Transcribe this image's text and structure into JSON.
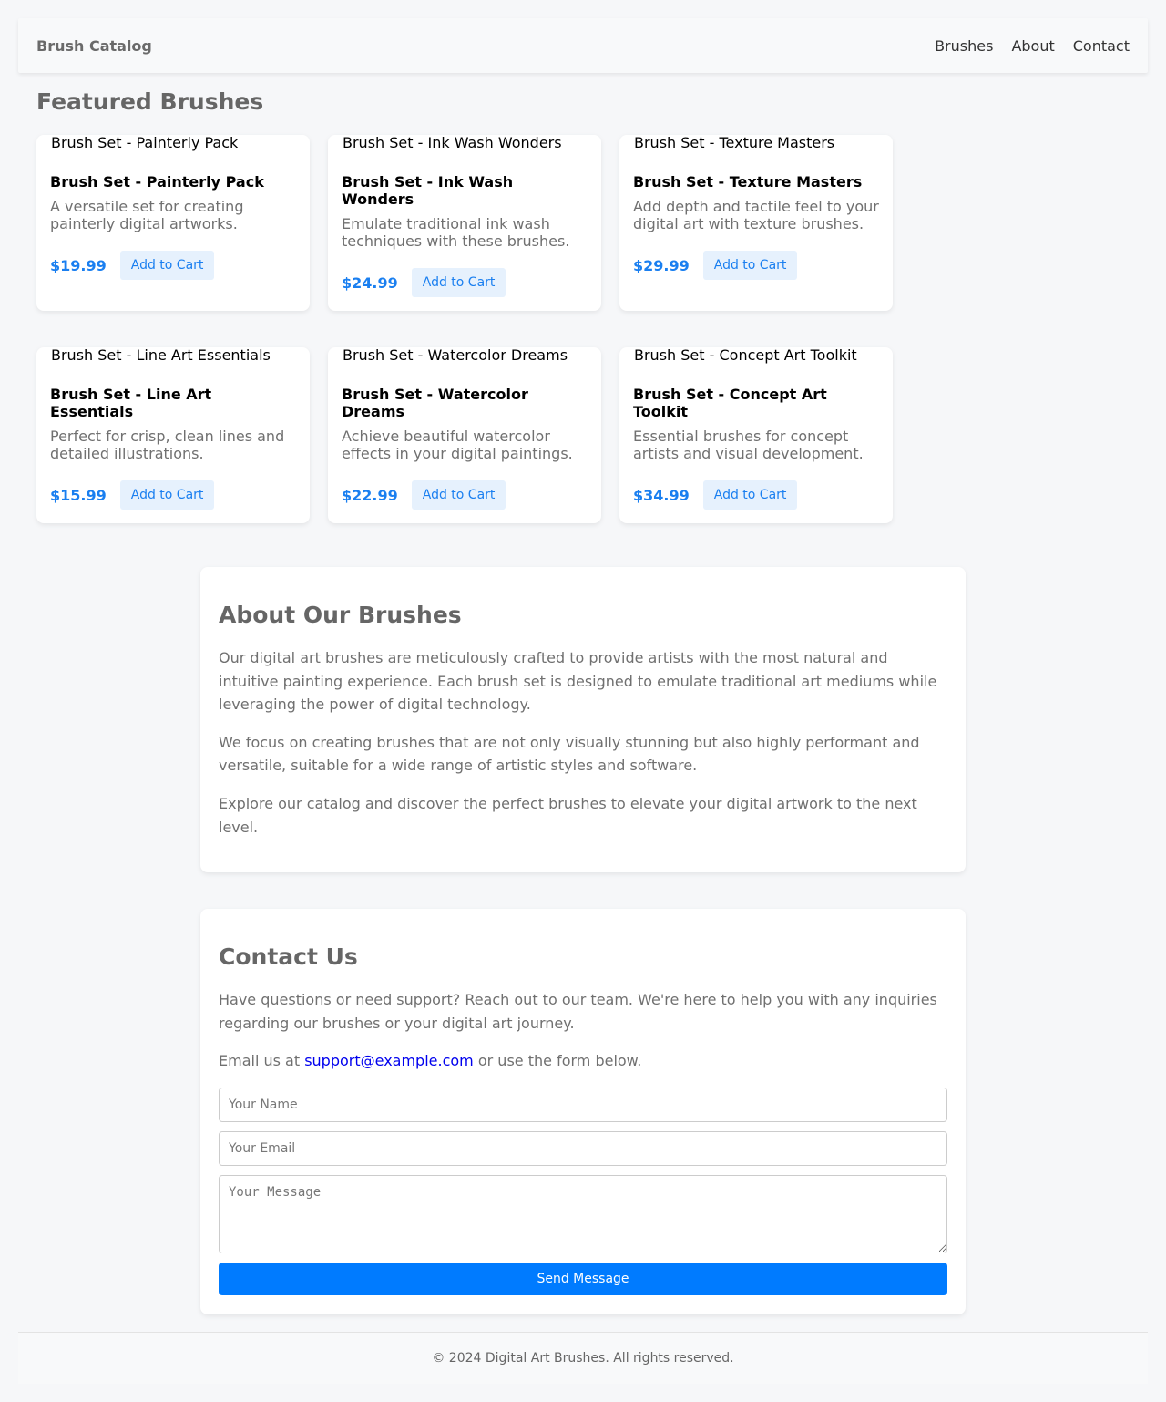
{
  "navbar": {
    "brand": "Brush Catalog",
    "links": [
      "Brushes",
      "About",
      "Contact"
    ]
  },
  "featured": {
    "title": "Featured Brushes",
    "add_label": "Add to Cart",
    "products": [
      {
        "image_alt": "Brush Set - Painterly Pack",
        "name": "Brush Set - Painterly Pack",
        "description": "A versatile set for creating painterly digital artworks.",
        "price": "$19.99"
      },
      {
        "image_alt": "Brush Set - Ink Wash Wonders",
        "name": "Brush Set - Ink Wash Wonders",
        "description": "Emulate traditional ink wash techniques with these brushes.",
        "price": "$24.99"
      },
      {
        "image_alt": "Brush Set - Texture Masters",
        "name": "Brush Set - Texture Masters",
        "description": "Add depth and tactile feel to your digital art with texture brushes.",
        "price": "$29.99"
      },
      {
        "image_alt": "Brush Set - Line Art Essentials",
        "name": "Brush Set - Line Art Essentials",
        "description": "Perfect for crisp, clean lines and detailed illustrations.",
        "price": "$15.99"
      },
      {
        "image_alt": "Brush Set - Watercolor Dreams",
        "name": "Brush Set - Watercolor Dreams",
        "description": "Achieve beautiful watercolor effects in your digital paintings.",
        "price": "$22.99"
      },
      {
        "image_alt": "Brush Set - Concept Art Toolkit",
        "name": "Brush Set - Concept Art Toolkit",
        "description": "Essential brushes for concept artists and visual development.",
        "price": "$34.99"
      }
    ]
  },
  "about": {
    "title": "About Our Brushes",
    "paragraphs": [
      "Our digital art brushes are meticulously crafted to provide artists with the most natural and intuitive painting experience. Each brush set is designed to emulate traditional art mediums while leveraging the power of digital technology.",
      "We focus on creating brushes that are not only visually stunning but also highly performant and versatile, suitable for a wide range of artistic styles and software.",
      "Explore our catalog and discover the perfect brushes to elevate your digital artwork to the next level."
    ]
  },
  "contact": {
    "title": "Contact Us",
    "intro": "Have questions or need support? Reach out to our team. We're here to help you with any inquiries regarding our brushes or your digital art journey.",
    "email_prefix": "Email us at ",
    "email": "support@example.com",
    "email_suffix": " or use the form below.",
    "name_placeholder": "Your Name",
    "name_value": "",
    "email_placeholder": "Your Email",
    "email_value": "",
    "message_placeholder": "Your Message",
    "message_value": "",
    "send_label": "Send Message"
  },
  "footer": {
    "text": "© 2024 Digital Art Brushes. All rights reserved."
  },
  "colors": {
    "accent": "#007bff",
    "price": "#1a7ff0",
    "button_light_bg": "#e6f1fd"
  }
}
